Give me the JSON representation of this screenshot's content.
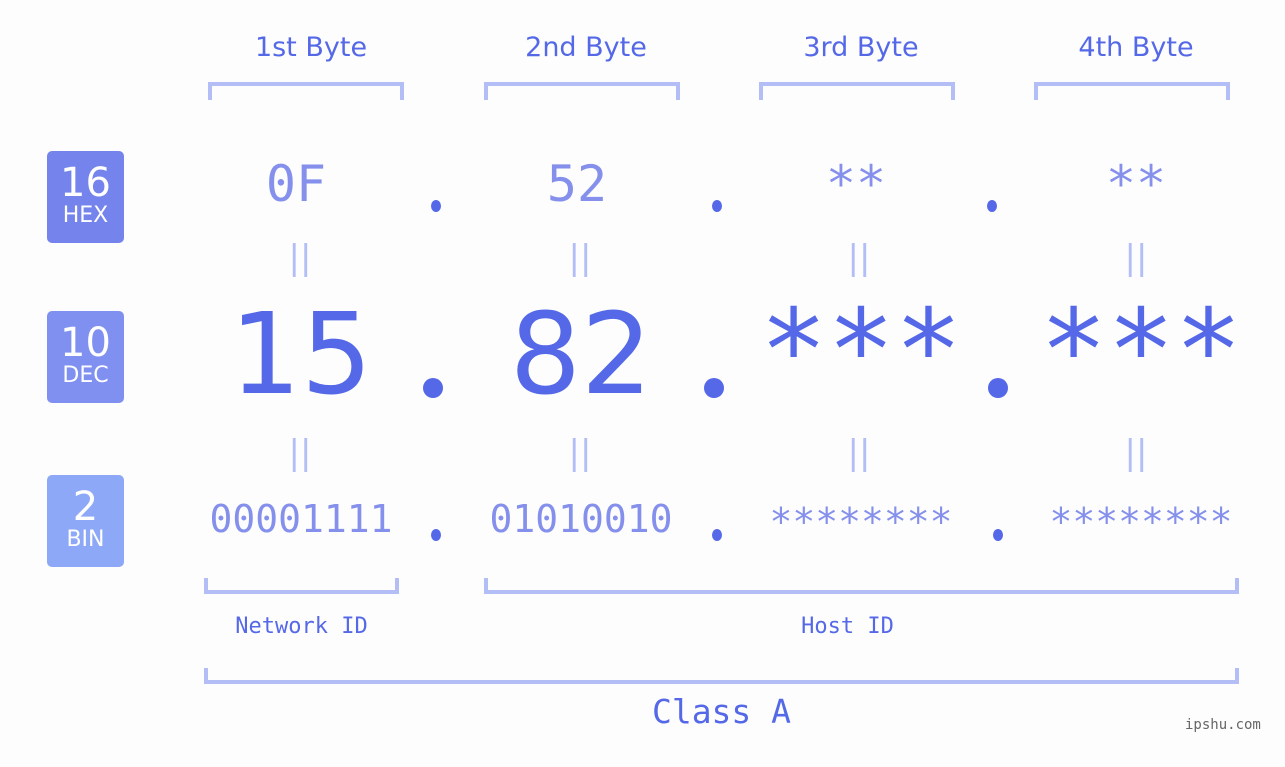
{
  "bytes": [
    {
      "header": "1st Byte",
      "hex": "0F",
      "dec": "15",
      "bin": "00001111"
    },
    {
      "header": "2nd Byte",
      "hex": "52",
      "dec": "82",
      "bin": "01010010"
    },
    {
      "header": "3rd Byte",
      "hex": "**",
      "dec": "***",
      "bin": "********"
    },
    {
      "header": "4th Byte",
      "hex": "**",
      "dec": "***",
      "bin": "********"
    }
  ],
  "badges": {
    "hex": {
      "base": "16",
      "label": "HEX",
      "color": "#7584ec"
    },
    "dec": {
      "base": "10",
      "label": "DEC",
      "color": "#8090f0"
    },
    "bin": {
      "base": "2",
      "label": "BIN",
      "color": "#8ea8f8"
    }
  },
  "equals_sign": "||",
  "network_id_label": "Network ID",
  "host_id_label": "Host ID",
  "class_label": "Class A",
  "watermark": "ipshu.com",
  "colors": {
    "accent": "#5468e8",
    "light_accent": "#8590ec",
    "bracket": "#b3bdf6",
    "background": "#fcfdfc"
  }
}
